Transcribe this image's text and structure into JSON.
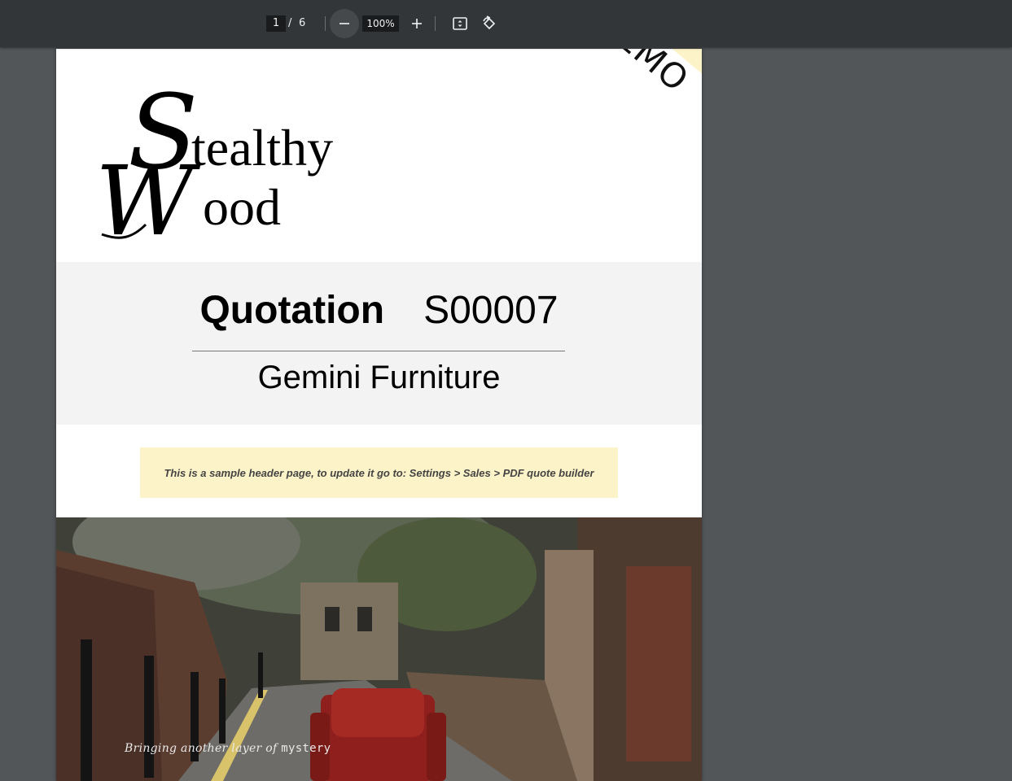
{
  "toolbar": {
    "current_page": "1",
    "page_separator": "/",
    "total_pages": "6",
    "zoom": "100%",
    "icons": [
      "zoom-out-icon",
      "zoom-in-icon",
      "fit-page-icon",
      "rotate-icon"
    ]
  },
  "document": {
    "ribbon_text": "DEMO",
    "logo_text": "Stealthy Wood",
    "quotation_label": "Quotation",
    "quotation_number": "S00007",
    "customer_name": "Gemini Furniture",
    "notice": "This is a sample header page, to update it go to: Settings > Sales > PDF quote builder",
    "photo_caption_script": "Bringing another layer of",
    "photo_caption_word": "mystery"
  },
  "colors": {
    "toolbar_bg": "#323639",
    "viewer_bg": "#525659",
    "band_bg": "#f3f3f3",
    "accent_yellow": "#fdf3c8"
  }
}
